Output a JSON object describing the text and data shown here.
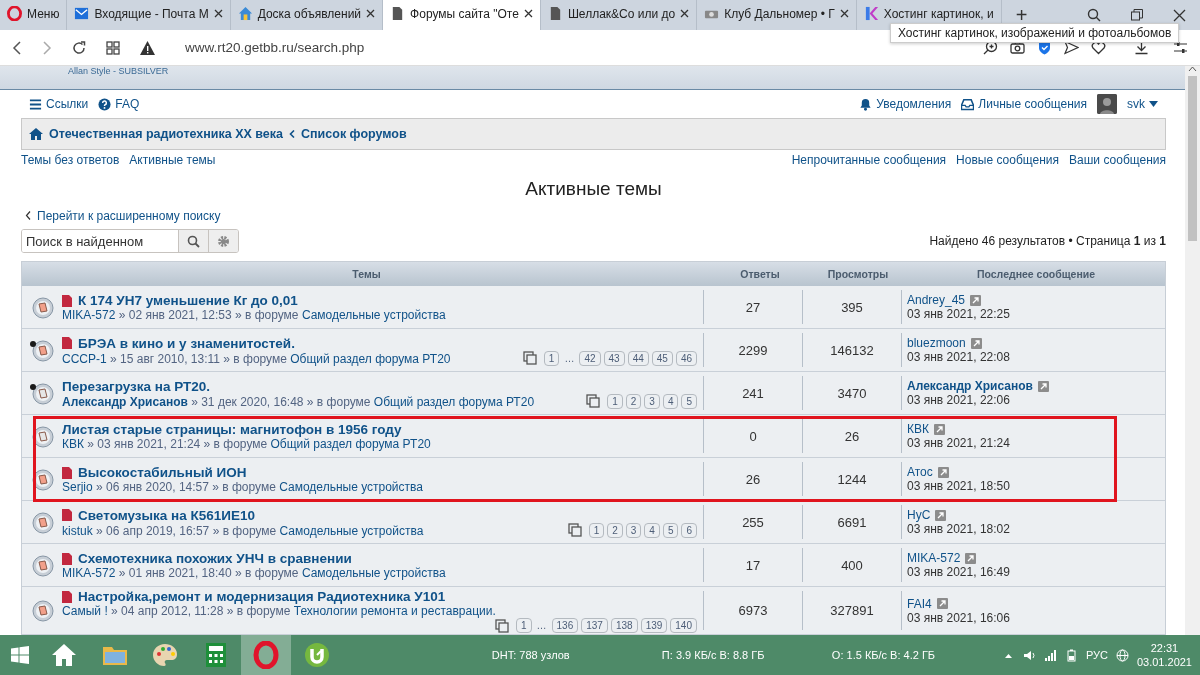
{
  "browser": {
    "tabs": [
      {
        "label": "Меню",
        "selected": false
      },
      {
        "label": "Входящие - Почта M",
        "selected": false
      },
      {
        "label": "Доска объявлений",
        "selected": false
      },
      {
        "label": "Форумы сайта \"Оте",
        "selected": true
      },
      {
        "label": "Шеллак&Co или до",
        "selected": false
      },
      {
        "label": "Клуб Дальномер • Г",
        "selected": false
      },
      {
        "label": "Хостинг картинок, и",
        "selected": false
      }
    ],
    "new_tab": "+",
    "tooltip": "Хостинг картинок, изображений и фотоальбомов",
    "address": "www.rt20.getbb.ru/search.php"
  },
  "forum": {
    "style_caption": "Allan Style - SUBSILVER",
    "nav_left": [
      "Ссылки",
      "FAQ"
    ],
    "nav_right": [
      "Уведомления",
      "Личные сообщения"
    ],
    "user": "svk",
    "breadcrumbs": [
      "Отечественная радиотехника XX века",
      "Список форумов"
    ],
    "links_left": [
      "Темы без ответов",
      "Активные темы"
    ],
    "links_right": [
      "Непрочитанные сообщения",
      "Новые сообщения",
      "Ваши сообщения"
    ],
    "title": "Активные темы",
    "back_link": "Перейти к расширенному поиску",
    "search": {
      "placeholder": "Поиск в найденном"
    },
    "results": "Найдено 46 результатов • Страница **1** из **1**",
    "table": {
      "columns": [
        "Темы",
        "Ответы",
        "Просмотры",
        "Последнее сообщение"
      ],
      "rows": [
        {
          "title": "К 174 УН7 уменьшение Кг до 0,01",
          "author": "MIKA-572",
          "author_bold": false,
          "date": "» 02 янв 2021, 12:53 » в форуме",
          "forum": "Самодельные устройства",
          "replies": "27",
          "views": "395",
          "last_author": "Andrey_45",
          "last_author_bold": false,
          "last_date": "03 янв 2021, 22:25",
          "unread": false,
          "hot": true,
          "highlighted": false,
          "pages": []
        },
        {
          "title": "БРЭА в кино и у знаменитостей.",
          "author": "CCCP-1",
          "author_bold": false,
          "date": "» 15 авг 2010, 13:11 » в форуме",
          "forum": "Общий раздел форума РТ20",
          "replies": "2299",
          "views": "146132",
          "last_author": "bluezmoon",
          "last_author_bold": false,
          "last_date": "03 янв 2021, 22:08",
          "unread": true,
          "hot": true,
          "highlighted": false,
          "pages": [
            {
              "label": "1",
              "kind": "page"
            },
            {
              "label": "…",
              "kind": "gap"
            },
            {
              "label": "42",
              "kind": "page"
            },
            {
              "label": "43",
              "kind": "page"
            },
            {
              "label": "44",
              "kind": "page"
            },
            {
              "label": "45",
              "kind": "page"
            },
            {
              "label": "46",
              "kind": "page"
            }
          ]
        },
        {
          "title": "Перезагрузка на РТ20.",
          "author": "Александр Хрисанов",
          "author_bold": true,
          "date": "» 31 дек 2020, 16:48 » в форуме",
          "forum": "Общий раздел форума РТ20",
          "replies": "241",
          "views": "3470",
          "last_author": "Александр Хрисанов",
          "last_author_bold": true,
          "last_date": "03 янв 2021, 22:06",
          "unread": true,
          "hot": false,
          "highlighted": false,
          "pages": [
            {
              "label": "1",
              "kind": "page"
            },
            {
              "label": "2",
              "kind": "page"
            },
            {
              "label": "3",
              "kind": "page"
            },
            {
              "label": "4",
              "kind": "page"
            },
            {
              "label": "5",
              "kind": "page"
            }
          ]
        },
        {
          "title": "Листая старые страницы: магнитофон в 1956 году",
          "author": "КВК",
          "author_bold": false,
          "date": "» 03 янв 2021, 21:24 » в форуме",
          "forum": "Общий раздел форума РТ20",
          "replies": "0",
          "views": "26",
          "last_author": "КВК",
          "last_author_bold": false,
          "last_date": "03 янв 2021, 21:24",
          "unread": false,
          "hot": false,
          "highlighted": true,
          "pages": []
        },
        {
          "title": "Высокостабильный ИОН",
          "author": "Serjio",
          "author_bold": false,
          "date": "» 06 янв 2020, 14:57 » в форуме",
          "forum": "Самодельные устройства",
          "replies": "26",
          "views": "1244",
          "last_author": "Атос",
          "last_author_bold": false,
          "last_date": "03 янв 2021, 18:50",
          "unread": false,
          "hot": true,
          "highlighted": true,
          "pages": []
        },
        {
          "title": "Светомузыка на К561ИЕ10",
          "author": "kistuk",
          "author_bold": false,
          "date": "» 06 апр 2019, 16:57 » в форуме",
          "forum": "Самодельные устройства",
          "replies": "255",
          "views": "6691",
          "last_author": "НуС",
          "last_author_bold": false,
          "last_date": "03 янв 2021, 18:02",
          "unread": false,
          "hot": true,
          "highlighted": false,
          "pages": [
            {
              "label": "1",
              "kind": "page"
            },
            {
              "label": "2",
              "kind": "page"
            },
            {
              "label": "3",
              "kind": "page"
            },
            {
              "label": "4",
              "kind": "page"
            },
            {
              "label": "5",
              "kind": "page"
            },
            {
              "label": "6",
              "kind": "page"
            }
          ]
        },
        {
          "title": "Схемотехника похожих УНЧ в сравнении",
          "author": "MIKA-572",
          "author_bold": false,
          "date": "» 01 янв 2021, 18:40 » в форуме",
          "forum": "Самодельные устройства",
          "replies": "17",
          "views": "400",
          "last_author": "MIKA-572",
          "last_author_bold": false,
          "last_date": "03 янв 2021, 16:49",
          "unread": false,
          "hot": true,
          "highlighted": false,
          "pages": []
        },
        {
          "title": "Настройка,ремонт и модернизация Радиотехника У101",
          "author": "Самый !",
          "author_bold": false,
          "date": "» 04 апр 2012, 11:28 » в форуме",
          "forum": "Технологии ремонта и реставрации.",
          "replies": "6973",
          "views": "327891",
          "last_author": "FAI4",
          "last_author_bold": false,
          "last_date": "03 янв 2021, 16:06",
          "unread": false,
          "hot": true,
          "highlighted": false,
          "pages": [
            {
              "label": "1",
              "kind": "page"
            },
            {
              "label": "…",
              "kind": "gap"
            },
            {
              "label": "136",
              "kind": "page"
            },
            {
              "label": "137",
              "kind": "page"
            },
            {
              "label": "138",
              "kind": "page"
            },
            {
              "label": "139",
              "kind": "page"
            },
            {
              "label": "140",
              "kind": "page"
            }
          ]
        }
      ]
    }
  },
  "taskbar": {
    "apps": [
      {
        "active": false
      },
      {
        "active": false
      },
      {
        "active": false
      },
      {
        "active": false
      },
      {
        "active": true
      },
      {
        "active": false
      }
    ],
    "stats": [
      "DHT: 788 узлов",
      "П: 3.9 КБ/с В: 8.8 ГБ",
      "О: 1.5 КБ/с В: 4.2 ГБ"
    ],
    "language": "РУС",
    "time": "22:31",
    "date": "03.01.2021"
  }
}
